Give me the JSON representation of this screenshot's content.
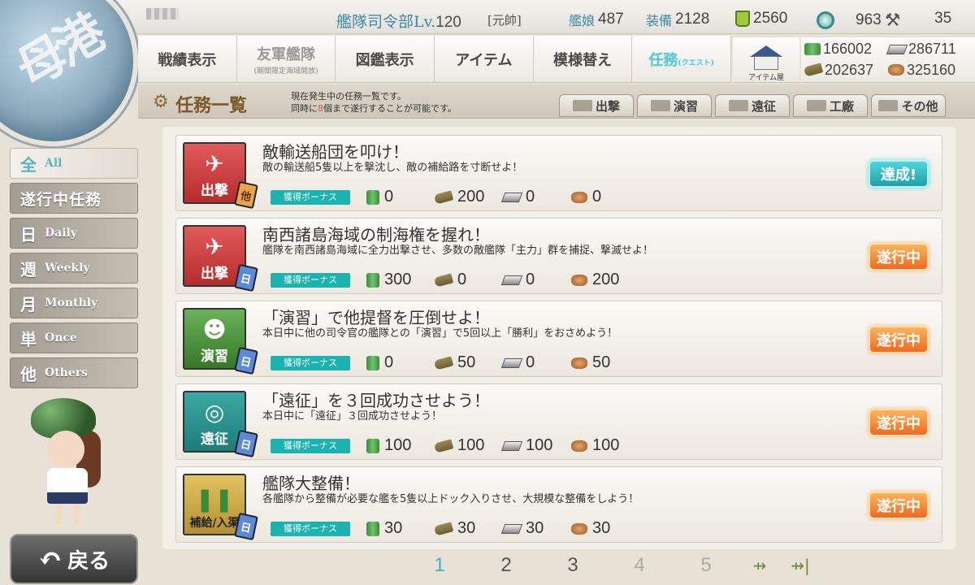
{
  "topbar": {
    "hq_label": "艦隊司令部",
    "lv_label": "Lv.",
    "hq_level": "120",
    "rank": "[元帥]",
    "ships_label": "艦娘",
    "ships": "487",
    "equip_label": "装備",
    "equip": "2128",
    "buckets": "2560",
    "devmats": "963",
    "screws": "35"
  },
  "nav": {
    "items": [
      {
        "label": "戦績表示",
        "sub": ""
      },
      {
        "label": "友軍艦隊",
        "sub": "(期間限定海域開放)"
      },
      {
        "label": "図鑑表示",
        "sub": ""
      },
      {
        "label": "アイテム",
        "sub": ""
      },
      {
        "label": "模様替え",
        "sub": ""
      },
      {
        "label": "任務",
        "sub": "(クエスト)"
      }
    ],
    "shop_label": "アイテム屋"
  },
  "resources": {
    "fuel": "166002",
    "steel": "286711",
    "ammo": "202637",
    "bauxite": "325160"
  },
  "header": {
    "title": "任務一覧",
    "desc_line1": "現在発生中の任務一覧です。",
    "desc_line2_a": "同時に",
    "desc_line2_num": "8",
    "desc_line2_b": "個まで遂行することが可能です。",
    "tabs": [
      "出撃",
      "演習",
      "遠征",
      "工廠",
      "その他"
    ]
  },
  "sidebar": {
    "filters": [
      {
        "kanji": "全",
        "en": "All"
      },
      {
        "kanji": "遂行中任務",
        "en": ""
      },
      {
        "kanji": "日",
        "en": "Daily"
      },
      {
        "kanji": "週",
        "en": "Weekly"
      },
      {
        "kanji": "月",
        "en": "Monthly"
      },
      {
        "kanji": "単",
        "en": "Once"
      },
      {
        "kanji": "他",
        "en": "Others"
      }
    ],
    "back_label": "戻る"
  },
  "quests": [
    {
      "badge": "出撃",
      "tag": "他",
      "title": "敵輸送船団を叩け！",
      "desc": "敵の輸送船5隻以上を撃沈し、敵の補給路を寸断せよ！",
      "bonus_label": "獲得ボーナス",
      "fuel": "0",
      "ammo": "200",
      "steel": "0",
      "bauxite": "0",
      "status": "達成!"
    },
    {
      "badge": "出撃",
      "tag": "日",
      "title": "南西諸島海域の制海権を握れ！",
      "desc": "艦隊を南西諸島海域に全力出撃させ、多数の敵艦隊「主力」群を捕捉、撃滅せよ！",
      "bonus_label": "獲得ボーナス",
      "fuel": "300",
      "ammo": "0",
      "steel": "0",
      "bauxite": "200",
      "status": "遂行中"
    },
    {
      "badge": "演習",
      "tag": "日",
      "title": "「演習」で他提督を圧倒せよ！",
      "desc": "本日中に他の司令官の艦隊との「演習」で5回以上「勝利」をおさめよう！",
      "bonus_label": "獲得ボーナス",
      "fuel": "0",
      "ammo": "50",
      "steel": "0",
      "bauxite": "50",
      "status": "遂行中"
    },
    {
      "badge": "遠征",
      "tag": "日",
      "title": "「遠征」を３回成功させよう！",
      "desc": "本日中に「遠征」３回成功させよう！",
      "bonus_label": "獲得ボーナス",
      "fuel": "100",
      "ammo": "100",
      "steel": "100",
      "bauxite": "100",
      "status": "遂行中"
    },
    {
      "badge": "補給/入渠",
      "tag": "日",
      "title": "艦隊大整備！",
      "desc": "各艦隊から整備が必要な艦を5隻以上ドック入りさせ、大規模な整備をしよう！",
      "bonus_label": "獲得ボーナス",
      "fuel": "30",
      "ammo": "30",
      "steel": "30",
      "bauxite": "30",
      "status": "遂行中"
    }
  ],
  "pagination": {
    "pages": [
      "1",
      "2",
      "3",
      "4",
      "5"
    ],
    "current": "1"
  }
}
